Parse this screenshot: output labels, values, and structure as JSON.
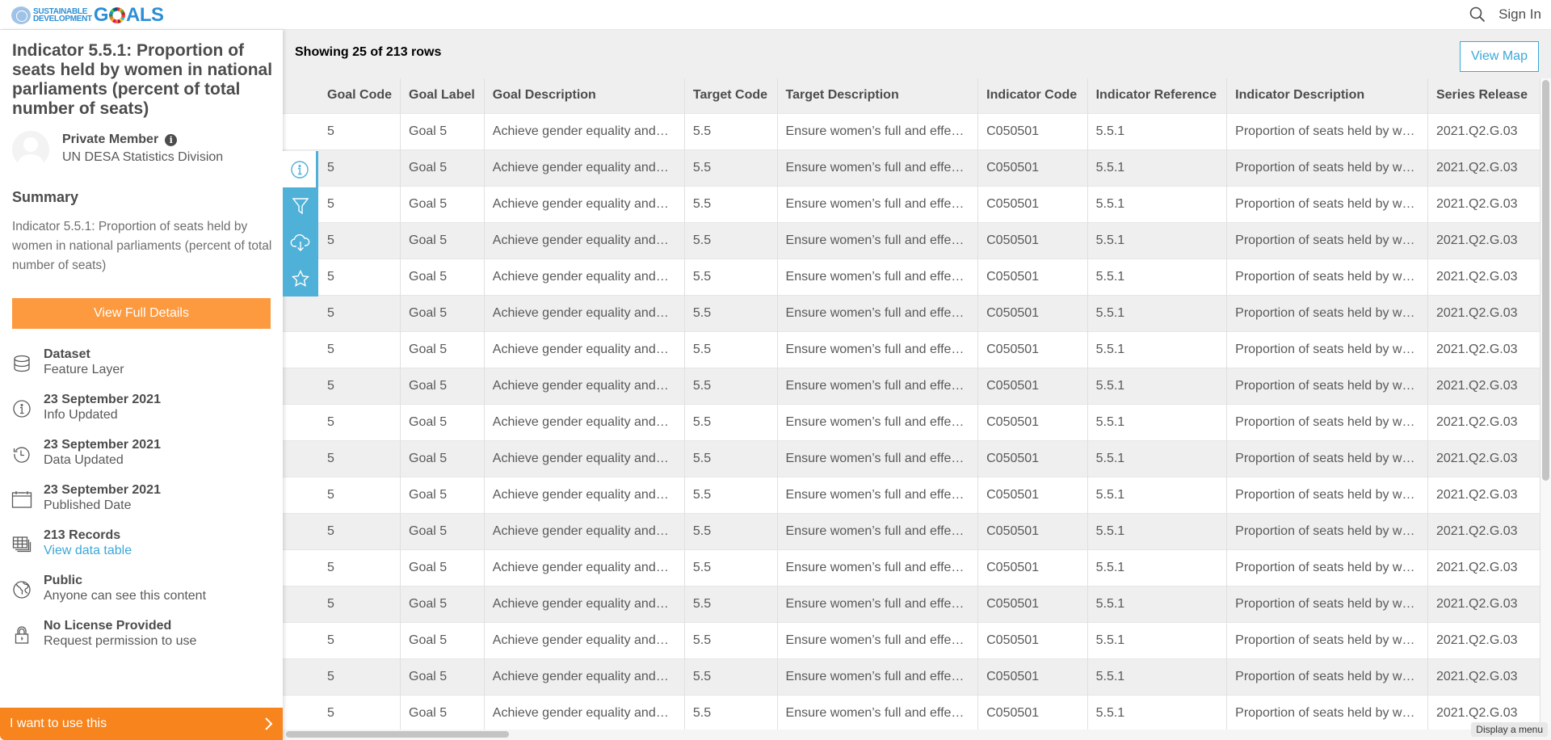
{
  "header": {
    "logo_small_line1": "SUSTAINABLE",
    "logo_small_line2": "DEVELOPMENT",
    "logo_goals_g": "G",
    "logo_goals_rest": "ALS",
    "search_icon": "search-icon",
    "signin_label": "Sign In"
  },
  "sidebar": {
    "title": "Indicator 5.5.1: Proportion of seats held by women in national parliaments (percent of total number of seats)",
    "owner_name": "Private Member",
    "owner_info_glyph": "i",
    "owner_org": "UN DESA Statistics Division",
    "summary_heading": "Summary",
    "summary_text": "Indicator 5.5.1: Proportion of seats held by women in national parliaments (percent of total number of seats)",
    "details_button": "View Full Details",
    "meta": [
      {
        "icon": "database-icon",
        "title": "Dataset",
        "sub": "Feature Layer"
      },
      {
        "icon": "info-icon",
        "title": "23 September 2021",
        "sub": "Info Updated"
      },
      {
        "icon": "history-icon",
        "title": "23 September 2021",
        "sub": "Data Updated"
      },
      {
        "icon": "calendar-icon",
        "title": "23 September 2021",
        "sub": "Published Date"
      },
      {
        "icon": "table-icon",
        "title": "213 Records",
        "sub": "View data table"
      },
      {
        "icon": "globe-icon",
        "title": "Public",
        "sub": "Anyone can see this content"
      },
      {
        "icon": "lock-icon",
        "title": "No License Provided",
        "sub": "Request permission to use"
      }
    ],
    "use_button": "I want to use this",
    "use_button_arrow": "›"
  },
  "main": {
    "showing": "Showing 25 of 213 rows",
    "view_map": "View Map",
    "toolbar": [
      "info-icon",
      "filter-icon",
      "cloud-download-icon",
      "star-icon"
    ],
    "columns": [
      "Goal Code",
      "Goal Label",
      "Goal Description",
      "Target Code",
      "Target Description",
      "Indicator Code",
      "Indicator Reference",
      "Indicator Description",
      "Series Release"
    ],
    "rows": [
      [
        "5",
        "Goal 5",
        "Achieve gender equality and…",
        "5.5",
        "Ensure women’s full and effe…",
        "C050501",
        "5.5.1",
        "Proportion of seats held by w…",
        "2021.Q2.G.03"
      ],
      [
        "5",
        "Goal 5",
        "Achieve gender equality and…",
        "5.5",
        "Ensure women’s full and effe…",
        "C050501",
        "5.5.1",
        "Proportion of seats held by w…",
        "2021.Q2.G.03"
      ],
      [
        "5",
        "Goal 5",
        "Achieve gender equality and…",
        "5.5",
        "Ensure women’s full and effe…",
        "C050501",
        "5.5.1",
        "Proportion of seats held by w…",
        "2021.Q2.G.03"
      ],
      [
        "5",
        "Goal 5",
        "Achieve gender equality and…",
        "5.5",
        "Ensure women’s full and effe…",
        "C050501",
        "5.5.1",
        "Proportion of seats held by w…",
        "2021.Q2.G.03"
      ],
      [
        "5",
        "Goal 5",
        "Achieve gender equality and…",
        "5.5",
        "Ensure women’s full and effe…",
        "C050501",
        "5.5.1",
        "Proportion of seats held by w…",
        "2021.Q2.G.03"
      ],
      [
        "5",
        "Goal 5",
        "Achieve gender equality and…",
        "5.5",
        "Ensure women’s full and effe…",
        "C050501",
        "5.5.1",
        "Proportion of seats held by w…",
        "2021.Q2.G.03"
      ],
      [
        "5",
        "Goal 5",
        "Achieve gender equality and…",
        "5.5",
        "Ensure women’s full and effe…",
        "C050501",
        "5.5.1",
        "Proportion of seats held by w…",
        "2021.Q2.G.03"
      ],
      [
        "5",
        "Goal 5",
        "Achieve gender equality and…",
        "5.5",
        "Ensure women’s full and effe…",
        "C050501",
        "5.5.1",
        "Proportion of seats held by w…",
        "2021.Q2.G.03"
      ],
      [
        "5",
        "Goal 5",
        "Achieve gender equality and…",
        "5.5",
        "Ensure women’s full and effe…",
        "C050501",
        "5.5.1",
        "Proportion of seats held by w…",
        "2021.Q2.G.03"
      ],
      [
        "5",
        "Goal 5",
        "Achieve gender equality and…",
        "5.5",
        "Ensure women’s full and effe…",
        "C050501",
        "5.5.1",
        "Proportion of seats held by w…",
        "2021.Q2.G.03"
      ],
      [
        "5",
        "Goal 5",
        "Achieve gender equality and…",
        "5.5",
        "Ensure women’s full and effe…",
        "C050501",
        "5.5.1",
        "Proportion of seats held by w…",
        "2021.Q2.G.03"
      ],
      [
        "5",
        "Goal 5",
        "Achieve gender equality and…",
        "5.5",
        "Ensure women’s full and effe…",
        "C050501",
        "5.5.1",
        "Proportion of seats held by w…",
        "2021.Q2.G.03"
      ],
      [
        "5",
        "Goal 5",
        "Achieve gender equality and…",
        "5.5",
        "Ensure women’s full and effe…",
        "C050501",
        "5.5.1",
        "Proportion of seats held by w…",
        "2021.Q2.G.03"
      ],
      [
        "5",
        "Goal 5",
        "Achieve gender equality and…",
        "5.5",
        "Ensure women’s full and effe…",
        "C050501",
        "5.5.1",
        "Proportion of seats held by w…",
        "2021.Q2.G.03"
      ],
      [
        "5",
        "Goal 5",
        "Achieve gender equality and…",
        "5.5",
        "Ensure women’s full and effe…",
        "C050501",
        "5.5.1",
        "Proportion of seats held by w…",
        "2021.Q2.G.03"
      ],
      [
        "5",
        "Goal 5",
        "Achieve gender equality and…",
        "5.5",
        "Ensure women’s full and effe…",
        "C050501",
        "5.5.1",
        "Proportion of seats held by w…",
        "2021.Q2.G.03"
      ],
      [
        "5",
        "Goal 5",
        "Achieve gender equality and…",
        "5.5",
        "Ensure women’s full and effe…",
        "C050501",
        "5.5.1",
        "Proportion of seats held by w…",
        "2021.Q2.G.03"
      ]
    ]
  },
  "tooltip": "Display a menu",
  "colors": {
    "accent_blue": "#3aa8d8",
    "toolbar_blue": "#4fb0d8",
    "orange_button": "#fd9a3f",
    "orange_cta": "#f7841c"
  }
}
